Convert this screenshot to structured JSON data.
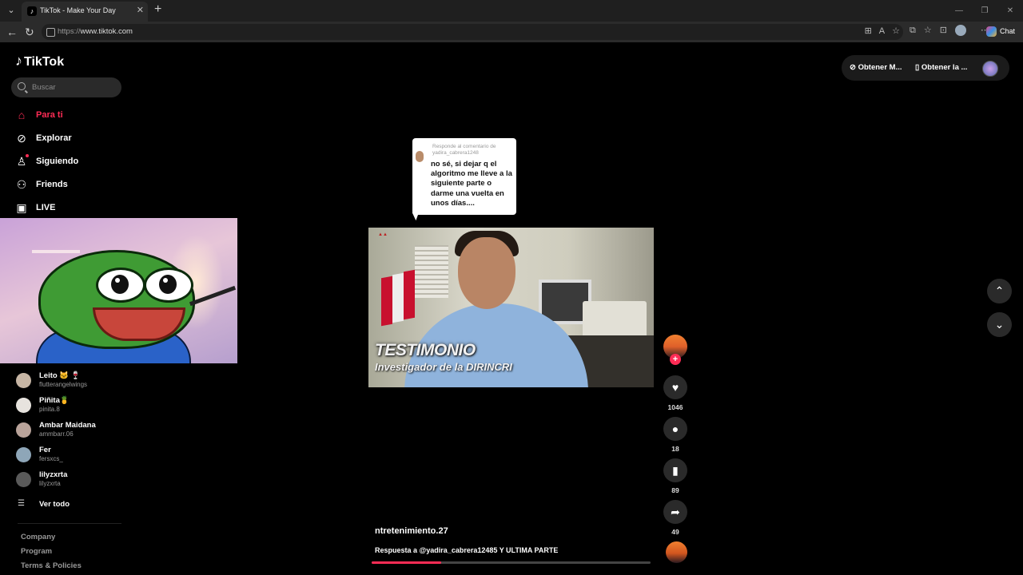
{
  "browser": {
    "tab_title": "TikTok - Make Your Day",
    "url_prefix": "https://",
    "url_host": "www.tiktok.com",
    "copilot_label": "Chat"
  },
  "brand": {
    "name": "TikTok",
    "accent": "#fe2c55"
  },
  "search": {
    "placeholder": "Buscar"
  },
  "nav": [
    {
      "label": "Para ti",
      "icon": "home-icon",
      "active": true
    },
    {
      "label": "Explorar",
      "icon": "compass-icon"
    },
    {
      "label": "Siguiendo",
      "icon": "following-icon"
    },
    {
      "label": "Friends",
      "icon": "friends-icon"
    },
    {
      "label": "LIVE",
      "icon": "live-icon"
    }
  ],
  "following": [
    {
      "name": "Leito 🐱 🍷",
      "handle": "flutterangelwings"
    },
    {
      "name": "Piñita🍍",
      "handle": "pinita.8"
    },
    {
      "name": "Ambar Maidana",
      "handle": "ammbarr.06"
    },
    {
      "name": "Fer",
      "handle": "fersxcs_"
    },
    {
      "name": "lilyzxrta",
      "handle": "lilyzxrta"
    }
  ],
  "see_all": "Ver todo",
  "footer_links": [
    "Company",
    "Program",
    "Terms & Policies"
  ],
  "top_right": {
    "coins_label": "Obtener M...",
    "app_label": "Obtener la ..."
  },
  "reply_card": {
    "header": "Responde al comentario de yadira_cabrera1248",
    "body": "no sé, si dejar q el algoritmo me lleve a la siguiente parte o darme una vuelta en unos días...."
  },
  "video": {
    "caption_line1": "TESTIMONIO",
    "caption_line2": "Investigador de la DIRINCRI",
    "progress": 0.25
  },
  "actions": {
    "likes": "1046",
    "comments": "18",
    "saves": "89",
    "shares": "49"
  },
  "post": {
    "author": "ntretenimiento.27",
    "caption": "Respuesta a @yadira_cabrera12485 Y ULTIMA PARTE"
  }
}
